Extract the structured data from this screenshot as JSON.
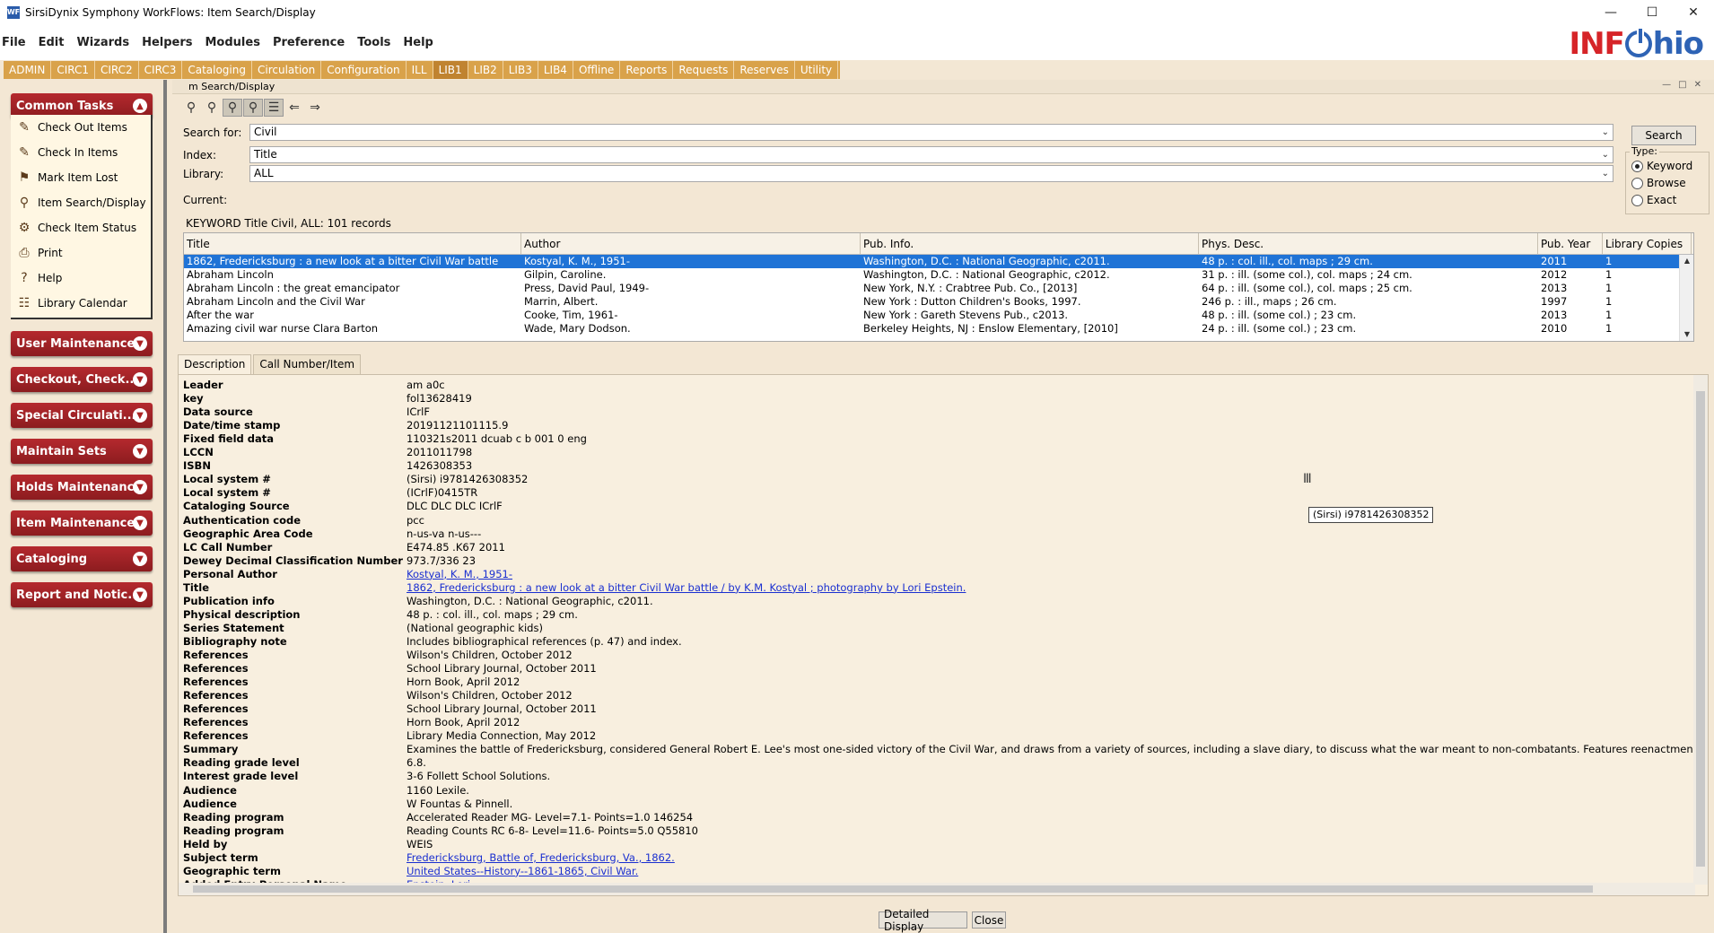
{
  "window": {
    "title": "SirsiDynix Symphony WorkFlows: Item Search/Display",
    "app_icon": "WF",
    "controls": [
      "minimize-icon",
      "maximize-icon",
      "close-icon"
    ]
  },
  "menu": [
    "File",
    "Edit",
    "Wizards",
    "Helpers",
    "Modules",
    "Preference",
    "Tools",
    "Help"
  ],
  "logo": {
    "part1": "INF",
    "part2": "hio"
  },
  "module_tabs": [
    "ADMIN",
    "CIRC1",
    "CIRC2",
    "CIRC3",
    "Cataloging",
    "Circulation",
    "Configuration",
    "ILL",
    "LIB1",
    "LIB2",
    "LIB3",
    "LIB4",
    "Offline",
    "Reports",
    "Requests",
    "Reserves",
    "Utility"
  ],
  "active_module": "LIB1",
  "sidebar": {
    "common_tasks_title": "Common Tasks",
    "tasks": [
      {
        "label": "Check Out Items",
        "icon": "checkout-icon"
      },
      {
        "label": "Check In Items",
        "icon": "checkin-icon"
      },
      {
        "label": "Mark Item Lost",
        "icon": "lost-icon"
      },
      {
        "label": "Item Search/Display",
        "icon": "search-icon"
      },
      {
        "label": "Check Item Status",
        "icon": "status-icon"
      },
      {
        "label": "Print",
        "icon": "print-icon"
      },
      {
        "label": "Help",
        "icon": "help-icon"
      },
      {
        "label": "Library Calendar",
        "icon": "calendar-icon"
      }
    ],
    "groups": [
      "User Maintenance",
      "Checkout, Check...",
      "Special Circulati...",
      "Maintain Sets",
      "Holds Maintenance",
      "Item Maintenance",
      "Cataloging",
      "Report and Notic..."
    ]
  },
  "inner_window": {
    "title": "m Search/Display"
  },
  "search": {
    "search_for_label": "Search for:",
    "search_for_value": "Civil",
    "index_label": "Index:",
    "index_value": "Title",
    "library_label": "Library:",
    "library_value": "ALL",
    "current_label": "Current:",
    "search_button": "Search",
    "type_label": "Type:",
    "types": [
      "Keyword",
      "Browse",
      "Exact"
    ],
    "selected_type": "Keyword"
  },
  "results": {
    "summary": "KEYWORD Title Civil, ALL: 101 records",
    "columns": [
      "Title",
      "Author",
      "Pub. Info.",
      "Phys. Desc.",
      "Pub. Year",
      "Library Copies"
    ],
    "rows": [
      [
        "1862, Fredericksburg : a new look at a bitter Civil War battle",
        "Kostyal, K. M., 1951-",
        "Washington, D.C. : National Geographic, c2011.",
        "48 p. : col. ill., col. maps ; 29 cm.",
        "2011",
        "1"
      ],
      [
        "Abraham Lincoln",
        "Gilpin, Caroline.",
        "Washington, D.C. : National Geographic, c2012.",
        "31 p. : ill. (some col.), col. maps ; 24 cm.",
        "2012",
        "1"
      ],
      [
        "Abraham Lincoln : the great emancipator",
        "Press, David Paul, 1949-",
        "New York, N.Y. : Crabtree Pub. Co., [2013]",
        "64 p. : ill. (some col.), col. maps ; 25 cm.",
        "2013",
        "1"
      ],
      [
        "Abraham Lincoln and the Civil War",
        "Marrin, Albert.",
        "New York : Dutton Children's Books, 1997.",
        "246 p. : ill., maps ; 26 cm.",
        "1997",
        "1"
      ],
      [
        "After the war",
        "Cooke, Tim, 1961-",
        "New York : Gareth Stevens Pub., c2013.",
        "48 p. : ill. (some col.) ; 23 cm.",
        "2013",
        "1"
      ],
      [
        "Amazing civil war nurse Clara Barton",
        "Wade, Mary Dodson.",
        "Berkeley Heights, NJ : Enslow Elementary, [2010]",
        "24 p. : ill. (some col.) ; 23 cm.",
        "2010",
        "1"
      ]
    ]
  },
  "detail_tabs": [
    "Description",
    "Call Number/Item"
  ],
  "description": [
    {
      "label": "Leader",
      "value": "am a0c"
    },
    {
      "label": "key",
      "value": "fol13628419"
    },
    {
      "label": "Data source",
      "value": "ICrlF"
    },
    {
      "label": "Date/time stamp",
      "value": "20191121101115.9"
    },
    {
      "label": "Fixed field data",
      "value": "110321s2011    dcuab  c b    001 0 eng"
    },
    {
      "label": "LCCN",
      "value": "2011011798"
    },
    {
      "label": "ISBN",
      "value": "1426308353"
    },
    {
      "label": "Local system #",
      "value": "(Sirsi) i9781426308352"
    },
    {
      "label": "Local system #",
      "value": "(ICrlF)0415TR"
    },
    {
      "label": "Cataloging Source",
      "value": "DLC DLC DLC ICrlF"
    },
    {
      "label": "Authentication code",
      "value": "pcc"
    },
    {
      "label": "Geographic Area Code",
      "value": "n-us-va n-us---"
    },
    {
      "label": "LC Call Number",
      "value": "E474.85 .K67 2011"
    },
    {
      "label": "Dewey Decimal Classification Number",
      "value": "973.7/336 23"
    },
    {
      "label": "Personal Author",
      "value": "Kostyal, K. M., 1951-",
      "link": true
    },
    {
      "label": "Title",
      "value": "1862, Fredericksburg : a new look at a bitter Civil War battle / by K.M. Kostyal ; photography by Lori Epstein.",
      "link": true
    },
    {
      "label": "Publication info",
      "value": "Washington, D.C. : National Geographic, c2011."
    },
    {
      "label": "Physical description",
      "value": "48 p. : col. ill., col. maps ; 29 cm."
    },
    {
      "label": "Series Statement",
      "value": "(National geographic kids)"
    },
    {
      "label": "Bibliography note",
      "value": "Includes bibliographical references (p. 47) and index."
    },
    {
      "label": "References",
      "value": "Wilson's Children, October 2012"
    },
    {
      "label": "References",
      "value": "School Library Journal, October 2011"
    },
    {
      "label": "References",
      "value": "Horn Book, April 2012"
    },
    {
      "label": "References",
      "value": "Wilson's Children, October 2012"
    },
    {
      "label": "References",
      "value": "School Library Journal, October 2011"
    },
    {
      "label": "References",
      "value": "Horn Book, April 2012"
    },
    {
      "label": "References",
      "value": "Library Media Connection, May 2012"
    },
    {
      "label": "Summary",
      "value": "Examines the battle of Fredericksburg, considered General Robert E. Lee's most one-sided victory of the Civil War, and draws from a variety of sources, including a slave diary, to discuss what the war meant to non-combatants. Features reenactmen"
    },
    {
      "label": "Reading grade level",
      "value": "6.8."
    },
    {
      "label": "Interest grade level",
      "value": "3-6 Follett School Solutions."
    },
    {
      "label": "Audience",
      "value": "1160 Lexile."
    },
    {
      "label": "Audience",
      "value": "W Fountas & Pinnell."
    },
    {
      "label": "Reading program",
      "value": "Accelerated Reader MG- Level=7.1- Points=1.0 146254"
    },
    {
      "label": "Reading program",
      "value": "Reading Counts RC 6-8- Level=11.6- Points=5.0 Q55810"
    },
    {
      "label": "Held by",
      "value": "WEIS"
    },
    {
      "label": "Subject term",
      "value": "Fredericksburg, Battle of, Fredericksburg, Va., 1862.",
      "link": true
    },
    {
      "label": "Geographic term",
      "value": "United States--History--1861-1865, Civil War.",
      "link": true
    },
    {
      "label": "Added Entry-Personal Name",
      "value": "Epstein, Lori.",
      "link": true
    }
  ],
  "tooltip": "(Sirsi) i9781426308352",
  "buttons": {
    "detailed_display": "Detailed Display",
    "close": "Close"
  },
  "colors": {
    "accent": "#d9a24a",
    "sidebar_head": "#a22428",
    "selection": "#1f73d6",
    "background": "#f3e7d4"
  }
}
